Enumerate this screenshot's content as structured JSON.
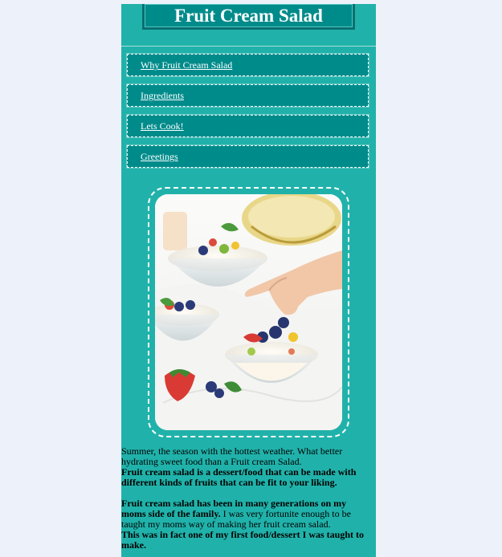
{
  "header": {
    "title": "Fruit Cream Salad"
  },
  "nav": {
    "items": [
      {
        "label": "Why Fruit Cream Salad"
      },
      {
        "label": "Ingredients"
      },
      {
        "label": "Lets Cook!"
      },
      {
        "label": "Greetings"
      }
    ]
  },
  "content": {
    "p1_plain": "Summer, the season with the hottest weather. What better hydrating sweet food than a Fruit cream Salad.",
    "p1_bold": "Fruit cream salad is a dessert/food that can be made with different kinds of fruits that can be fit to your liking.",
    "p2_bold": "Fruit cream salad has been in many generations on my moms side of the family.",
    "p2_plain": " I was very fortunite enough to be taught my moms way of making her fruit cream salad.",
    "p3_bold": "This was in fact one of my first food/dessert I was taught to make."
  },
  "colors": {
    "page_bg": "#edf1f9",
    "panel_bg": "#20b2aa",
    "nav_bg": "#008b8b",
    "text": "#000000",
    "link": "#ffffff"
  }
}
